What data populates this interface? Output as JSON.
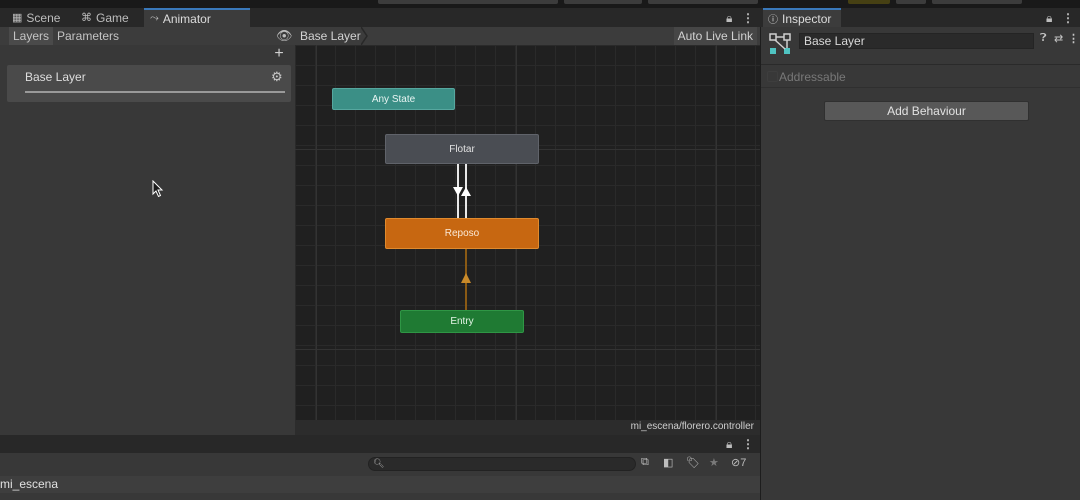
{
  "tabs": [
    {
      "label": "Scene",
      "icon": "grid-icon"
    },
    {
      "label": "Game",
      "icon": "gamepad-icon"
    },
    {
      "label": "Animator",
      "icon": "animator-icon",
      "active": true
    }
  ],
  "left_panel": {
    "tabs": [
      "Layers",
      "Parameters"
    ],
    "active_tab": "Layers",
    "layers": [
      {
        "name": "Base Layer",
        "weight": 1.0
      }
    ]
  },
  "graph": {
    "breadcrumb": "Base Layer",
    "auto_live_link": "Auto Live Link",
    "states": {
      "any_state": "Any State",
      "flotar": "Flotar",
      "reposo": "Reposo",
      "entry": "Entry"
    },
    "asset_path": "mi_escena/florero.controller"
  },
  "inspector": {
    "tab_label": "Inspector",
    "object_name": "Base Layer",
    "addressable_label": "Addressable",
    "addressable_checked": false,
    "add_behaviour_label": "Add Behaviour"
  },
  "bottom": {
    "hidden_count": "7",
    "scene_name": "mi_escena"
  },
  "colors": {
    "any_state": "#3b8f86",
    "default_state": "#4a4d53",
    "default_state_orange": "#c76711",
    "entry": "#1f7a33",
    "tab_accent": "#3a79bb"
  }
}
